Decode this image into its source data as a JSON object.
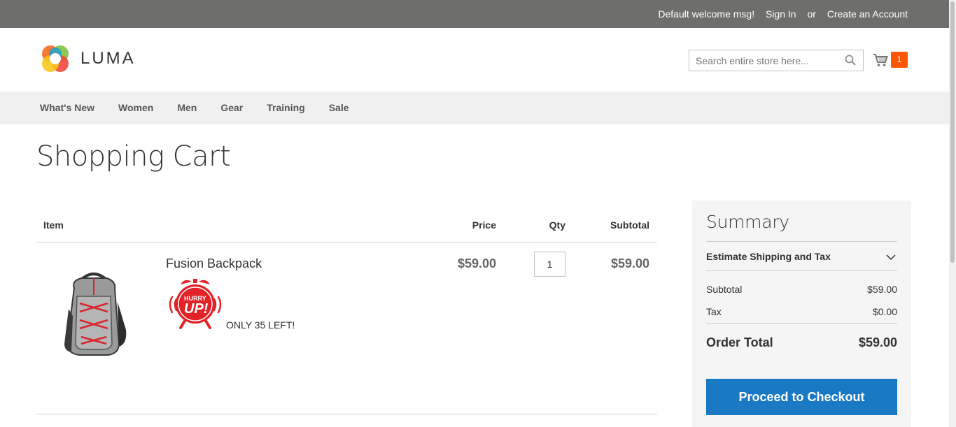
{
  "topbar": {
    "welcome": "Default welcome msg!",
    "sign_in": "Sign In",
    "or": "or",
    "create_account": "Create an Account"
  },
  "header": {
    "logo_text": "LUMA",
    "search_placeholder": "Search entire store here...",
    "cart_count": "1"
  },
  "nav": {
    "items": [
      "What's New",
      "Women",
      "Men",
      "Gear",
      "Training",
      "Sale"
    ]
  },
  "page": {
    "title": "Shopping Cart"
  },
  "cart": {
    "headers": {
      "item": "Item",
      "price": "Price",
      "qty": "Qty",
      "subtotal": "Subtotal"
    },
    "items": [
      {
        "name": "Fusion Backpack",
        "badge_top": "HURRY",
        "badge_main": "UP!",
        "stock": "ONLY 35 LEFT!",
        "price": "$59.00",
        "qty": "1",
        "subtotal": "$59.00"
      }
    ]
  },
  "summary": {
    "title": "Summary",
    "estimate": "Estimate Shipping and Tax",
    "subtotal_label": "Subtotal",
    "subtotal_value": "$59.00",
    "tax_label": "Tax",
    "tax_value": "$0.00",
    "total_label": "Order Total",
    "total_value": "$59.00",
    "checkout": "Proceed to Checkout"
  },
  "colors": {
    "topbar": "#6e6e6c",
    "nav": "#f0f0f0",
    "accent": "#1979c3",
    "cart_badge": "#ff5501",
    "summary_bg": "#f5f5f5"
  }
}
